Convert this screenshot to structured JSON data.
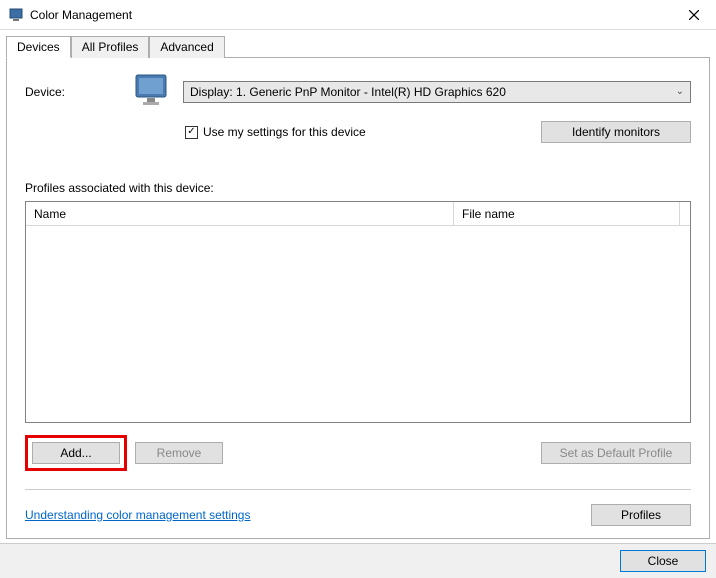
{
  "titlebar": {
    "title": "Color Management"
  },
  "tabs": {
    "devices": "Devices",
    "all_profiles": "All Profiles",
    "advanced": "Advanced"
  },
  "device": {
    "label": "Device:",
    "selected": "Display: 1. Generic PnP Monitor - Intel(R) HD Graphics 620",
    "use_my_settings": "Use my settings for this device",
    "identify": "Identify monitors"
  },
  "profiles": {
    "associated_label": "Profiles associated with this device:",
    "col_name": "Name",
    "col_file": "File name"
  },
  "buttons": {
    "add": "Add...",
    "remove": "Remove",
    "set_default": "Set as Default Profile",
    "profiles": "Profiles",
    "close": "Close"
  },
  "link": {
    "understanding": "Understanding color management settings"
  }
}
